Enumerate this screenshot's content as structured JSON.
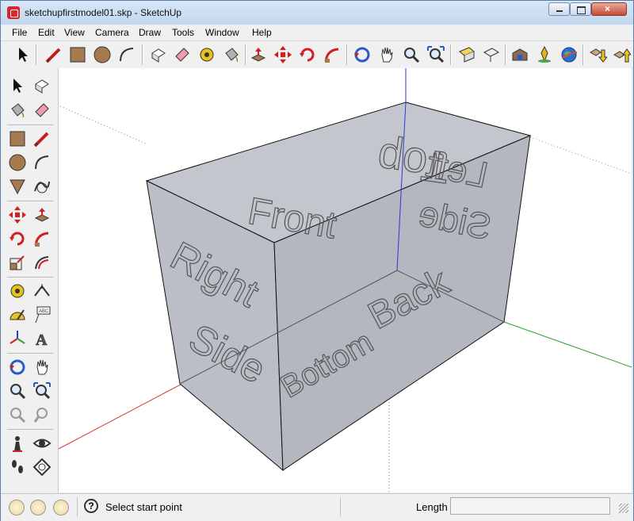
{
  "window": {
    "title": "sketchupfirstmodel01.skp - SketchUp",
    "buttons": {
      "minimize": "minimize",
      "maximize": "maximize",
      "close": "×"
    }
  },
  "menubar": {
    "items": [
      "File",
      "Edit",
      "View",
      "Camera",
      "Draw",
      "Tools",
      "Window",
      "Help"
    ]
  },
  "toolbar": {
    "icons": [
      "select-icon",
      "line-icon",
      "rectangle-icon",
      "circle-icon",
      "arc-icon",
      "make-component-icon",
      "eraser-icon",
      "tape-measure-icon",
      "paint-bucket-icon",
      "push-pull-icon",
      "move-icon",
      "rotate-icon",
      "follow-me-icon",
      "orbit-icon",
      "pan-icon",
      "zoom-icon",
      "zoom-extents-icon",
      "section-plane-icon",
      "previous-view-icon",
      "3d-warehouse-icon",
      "add-location-icon",
      "google-earth-icon",
      "get-models-icon",
      "share-model-icon"
    ]
  },
  "model_labels": {
    "top": "Top",
    "front": "Front",
    "left_side": "Left\nSide",
    "right_side": "Right\nSide",
    "back": "Back",
    "bottom": "Bottom"
  },
  "scene_text": {
    "top": "Top",
    "front": "Front",
    "left": "Left",
    "left_side": "Side",
    "right": "Right",
    "right_side": "Side",
    "back": "Back",
    "bottom": "Bottom"
  },
  "colors": {
    "axis_red": "#d23a3a",
    "axis_green": "#2fa52f",
    "axis_blue": "#2a3ad6",
    "face": "#b9bcc4",
    "edge": "#111111"
  },
  "statusbar": {
    "status_text": "Select start point",
    "length_label": "Length",
    "length_value": ""
  }
}
